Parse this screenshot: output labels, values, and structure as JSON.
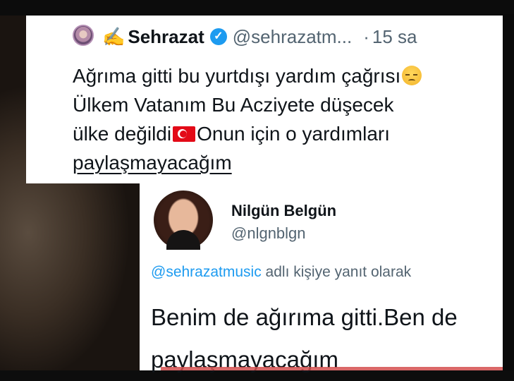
{
  "tweet_original": {
    "display_name": "Sehrazat",
    "handle": "@sehrazatm...",
    "dot": "·",
    "time": "15 sa",
    "text_lines": [
      "Ağrıma gitti bu yurtdışı yardım çağrısı",
      "Ülkem Vatanım Bu Acziyete düşecek",
      "ülke değildi",
      "Onun için o yardımları",
      "paylaşmayacağım"
    ],
    "icons": {
      "name_prefix": "writing-hand-icon",
      "verified": "verified-badge-icon",
      "emoji_end_line1": "pensive-face-emoji",
      "flag": "turkey-flag-emoji"
    },
    "colors": {
      "verified": "#1d9bf0",
      "text": "#0f1419",
      "meta": "#536471"
    }
  },
  "tweet_reply": {
    "display_name": "Nilgün Belgün",
    "handle": "@nlgnblgn",
    "reply_context_mention": "@sehrazatmusic",
    "reply_context_text": "adlı kişiye yanıt olarak",
    "text_lines": [
      "Benim de ağırıma gitti.Ben de",
      "paylaşmayacağım"
    ],
    "colors": {
      "mention": "#1d9bf0"
    }
  }
}
